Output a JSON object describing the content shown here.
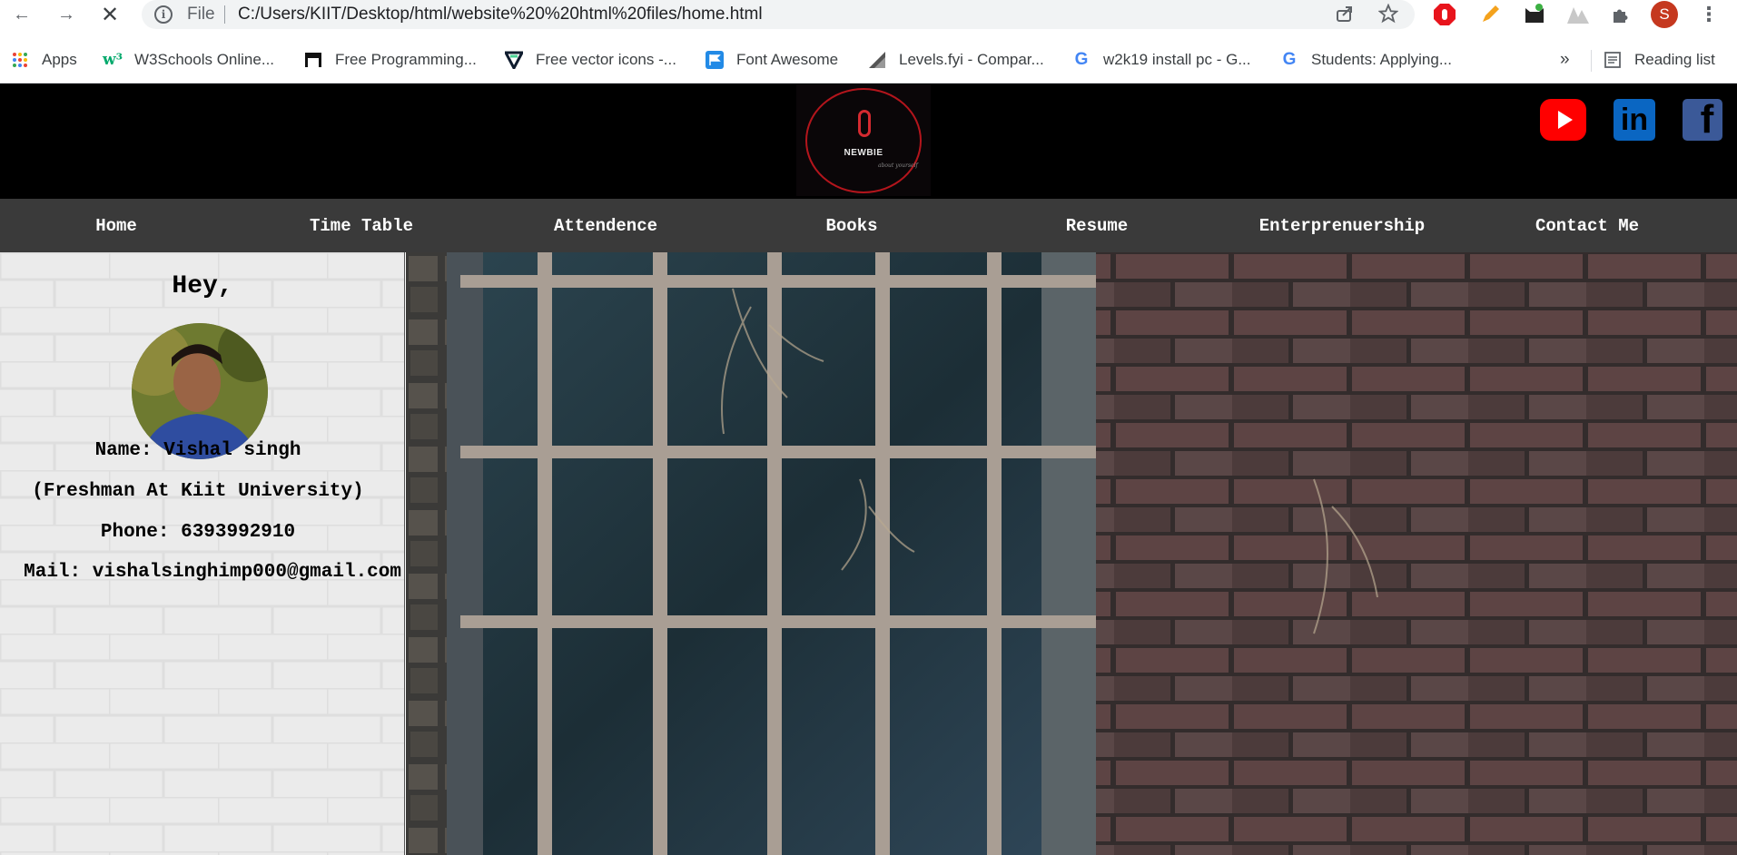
{
  "browser": {
    "omnibox": {
      "scheme_label": "File",
      "url": "C:/Users/KIIT/Desktop/html/website%20%20html%20files/home.html"
    },
    "profile_initial": "S",
    "bookmarks": [
      {
        "label": "Apps",
        "icon": "apps-grid-icon"
      },
      {
        "label": "W3Schools Online...",
        "icon": "w3schools-icon"
      },
      {
        "label": "Free Programming...",
        "icon": "page-icon"
      },
      {
        "label": "Free vector icons -...",
        "icon": "flaticon-icon"
      },
      {
        "label": "Font Awesome",
        "icon": "flag-icon"
      },
      {
        "label": "Levels.fyi - Compar...",
        "icon": "levels-icon"
      },
      {
        "label": "w2k19 install pc - G...",
        "icon": "google-icon"
      },
      {
        "label": "Students: Applying...",
        "icon": "google-icon"
      }
    ],
    "overflow_label": "»",
    "reading_list_label": "Reading list"
  },
  "site": {
    "logo": {
      "text": "NEWBIE",
      "subtext": "about yourself"
    },
    "social": [
      "youtube-icon",
      "linkedin-icon",
      "facebook-icon"
    ],
    "nav": [
      "Home",
      "Time Table",
      "Attendence",
      "Books",
      "Resume",
      "Enterprenuership",
      "Contact Me"
    ],
    "profile": {
      "greeting": "Hey,",
      "name": "Name: Vishal singh",
      "title": "(Freshman At Kiit University)",
      "phone": "Phone: 6393992910",
      "mail": "Mail: vishalsinghimp000@gmail.com"
    }
  },
  "colors": {
    "header_bg": "#000000",
    "nav_bg": "#3a3a3a",
    "sidebar_bg": "#eeeeee",
    "youtube": "#ff0000",
    "linkedin": "#0a66c2",
    "facebook": "#3b5998"
  }
}
